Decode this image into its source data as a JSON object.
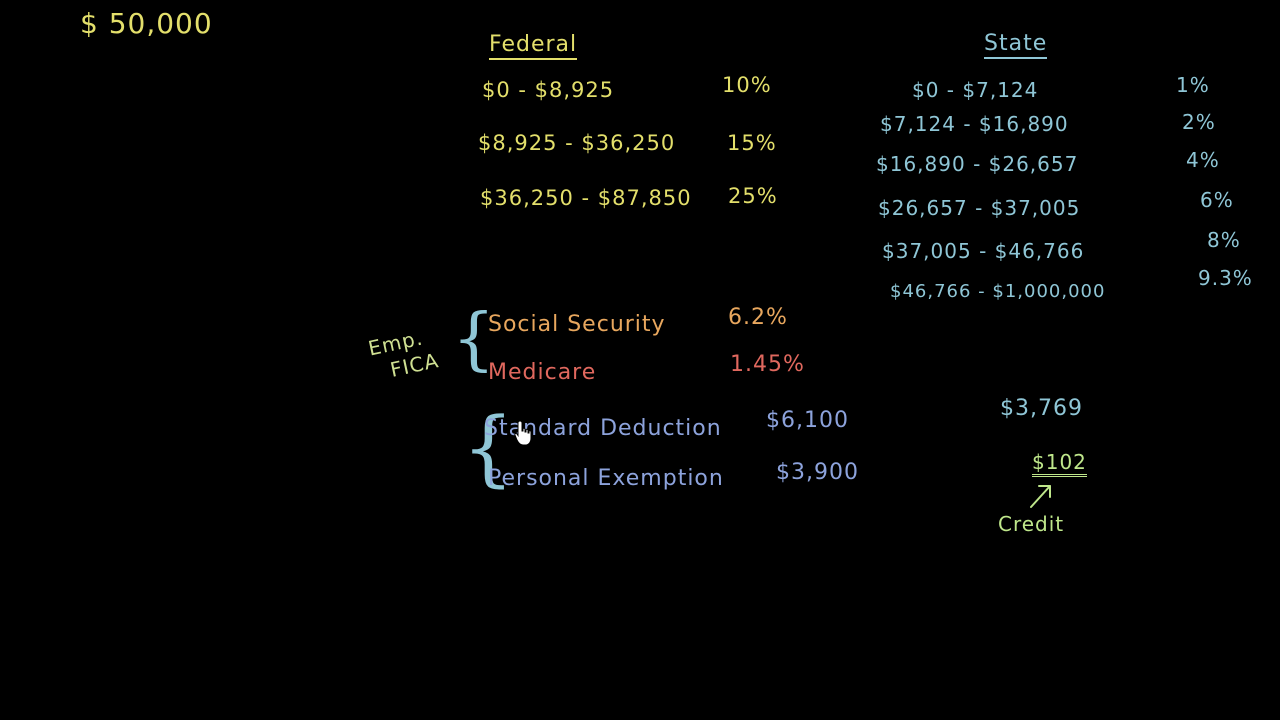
{
  "colors": {
    "background": "#000000",
    "yellow": "#e3df6b",
    "orange": "#e8a75e",
    "red": "#e0685e",
    "blue": "#8da3dc",
    "teal": "#8fc6d6",
    "pale_green": "#cfe092",
    "green": "#bfe78b"
  },
  "income": "$ 50,000",
  "federal": {
    "heading": "Federal",
    "brackets": [
      {
        "range": "$0 - $8,925",
        "rate": "10%"
      },
      {
        "range": "$8,925 - $36,250",
        "rate": "15%"
      },
      {
        "range": "$36,250 - $87,850",
        "rate": "25%"
      }
    ]
  },
  "state": {
    "heading": "State",
    "brackets": [
      {
        "range": "$0 - $7,124",
        "rate": "1%"
      },
      {
        "range": "$7,124 - $16,890",
        "rate": "2%"
      },
      {
        "range": "$16,890 - $26,657",
        "rate": "4%"
      },
      {
        "range": "$26,657 - $37,005",
        "rate": "6%"
      },
      {
        "range": "$37,005 - $46,766",
        "rate": "8%"
      },
      {
        "range": "$46,766 - $1,000,000",
        "rate": "9.3%"
      }
    ]
  },
  "fica": {
    "label_line1": "Emp.",
    "label_line2": "FICA",
    "items": [
      {
        "name": "Social Security",
        "rate": "6.2%"
      },
      {
        "name": "Medicare",
        "rate": "1.45%"
      }
    ]
  },
  "deductions": [
    {
      "name": "Standard Deduction",
      "amount": "$6,100"
    },
    {
      "name": "Personal Exemption",
      "amount": "$3,900"
    }
  ],
  "state_tax_total": "$3,769",
  "credit": {
    "amount": "$102",
    "label": "Credit"
  },
  "icons": {
    "cursor": "hand-pointer-icon",
    "arrow": "arrow-up-right-icon"
  }
}
